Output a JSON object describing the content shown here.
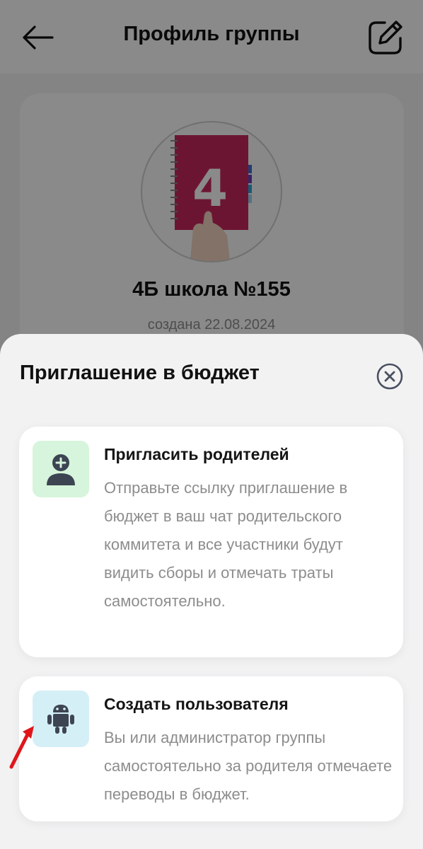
{
  "header": {
    "title": "Профиль группы"
  },
  "profile": {
    "group_name": "4Б школа №155",
    "created": "создана 22.08.2024",
    "avatar_digit": "4"
  },
  "sheet": {
    "title": "Приглашение в бюджет",
    "options": [
      {
        "title": "Пригласить родителей",
        "description": "Отправьте ссылку приглашение в бюджет в ваш чат родительского коммитета и все участники будут видить сборы и отмечать траты самостоятельно.",
        "icon": "add-user-icon"
      },
      {
        "title": "Создать пользователя",
        "description": "Вы или администратор группы самостоятельно за родителя отмечаете переводы в бюджет.",
        "icon": "robot-icon"
      }
    ]
  },
  "colors": {
    "accent_green_bg": "#d6f5dc",
    "accent_blue_bg": "#d5eff7",
    "icon_dark": "#3d4452",
    "annotation_arrow": "#e0161b"
  }
}
